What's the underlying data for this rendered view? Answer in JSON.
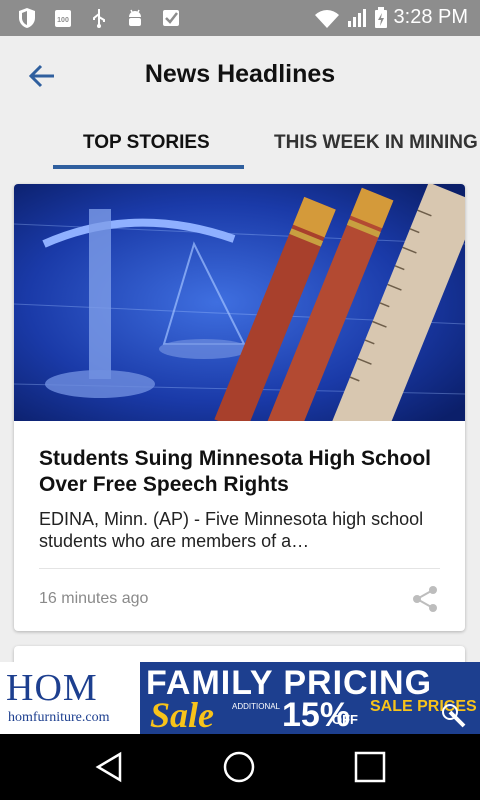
{
  "status_bar": {
    "time": "3:28 PM"
  },
  "app_bar": {
    "title": "News Headlines"
  },
  "tabs": [
    {
      "label": "TOP STORIES",
      "active": true
    },
    {
      "label": "THIS WEEK IN MINING",
      "active": false
    }
  ],
  "articles": [
    {
      "title": "Students Suing Minnesota High School Over Free Speech Rights",
      "snippet": "EDINA, Minn. (AP) - Five Minnesota high school students who are members of a…",
      "time": "16 minutes ago"
    }
  ],
  "ad": {
    "brand": "HOM",
    "site": "homfurniture.com",
    "headline": "FAMILY PRICING",
    "sale": "Sale",
    "additional": "ADDITIONAL",
    "percent": "15%",
    "off": "OFF",
    "prices": "SALE PRICES"
  },
  "colors": {
    "accent": "#2f5f9e",
    "status_bar": "#8d8d8d",
    "ad_blue": "#1d3f8f",
    "ad_yellow": "#f7c31a"
  }
}
